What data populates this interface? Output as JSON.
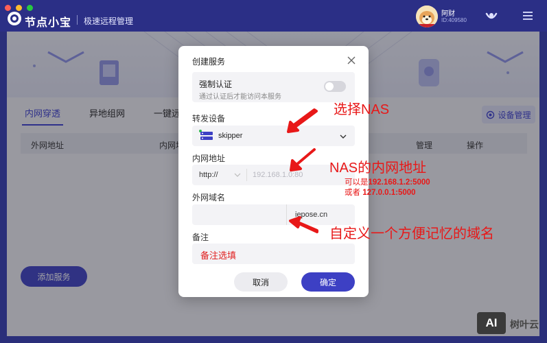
{
  "window": {
    "controls": {
      "close_color": "#ff5f57",
      "minimize_color": "#febc2e",
      "zoom_color": "#28c840"
    }
  },
  "header": {
    "app_name": "节点小宝",
    "subtitle": "极速远程管理",
    "user": {
      "name": "阿财",
      "id": "ID:409580"
    },
    "icons": [
      "logo-icon",
      "network-icon",
      "menu-icon"
    ]
  },
  "main": {
    "tabs": [
      {
        "label": "内网穿透",
        "active": true
      },
      {
        "label": "异地组网",
        "active": false
      },
      {
        "label": "一键远",
        "active": false
      }
    ],
    "device_management_label": "设备管理",
    "table_headers": {
      "external_address": "外网地址",
      "internal_address": "内网地",
      "manage": "管理",
      "operation": "操作"
    },
    "add_service_label": "添加服务"
  },
  "dialog": {
    "title": "创建服务",
    "force_auth": {
      "title": "强制认证",
      "desc": "通过认证后才能访问本服务",
      "enabled": false
    },
    "forward_device": {
      "label": "转发设备",
      "value": "skipper"
    },
    "internal_address": {
      "label": "内网地址",
      "protocol": "http://",
      "placeholder": "192.168.1.0:80"
    },
    "external_domain": {
      "label": "外网域名",
      "value": "",
      "suffix": "iepose.cn"
    },
    "remark": {
      "label": "备注",
      "value": "备注选填"
    },
    "cancel_label": "取消",
    "confirm_label": "确定"
  },
  "annotations": {
    "select_nas": "选择NAS",
    "nas_internal": "NAS的内网地址",
    "example_line1_prefix": "可以是",
    "example_line1_value": "192.168.1.2:5000",
    "example_line2_prefix": "或者 ",
    "example_line2_value": "127.0.0.1:5000",
    "custom_domain": "自定义一个方便记忆的域名",
    "color": "#e81818"
  },
  "watermark": {
    "badge": "AI",
    "text": "树叶云"
  },
  "colors": {
    "brand": "#3d40c4",
    "titlebar": "#2b2f86"
  }
}
